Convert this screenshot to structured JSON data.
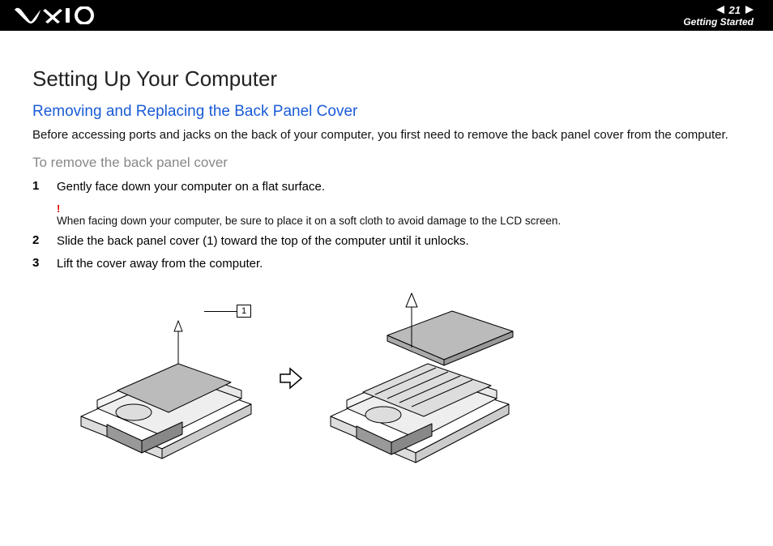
{
  "header": {
    "logo_alt": "VAIO",
    "page_number": "21",
    "section": "Getting Started"
  },
  "title": "Setting Up Your Computer",
  "subtitle": "Removing and Replacing the Back Panel Cover",
  "intro": "Before accessing ports and jacks on the back of your computer, you first need to remove the back panel cover from the computer.",
  "procedure_heading": "To remove the back panel cover",
  "steps": [
    {
      "num": "1",
      "text": "Gently face down your computer on a flat surface."
    },
    {
      "num": "2",
      "text": "Slide the back panel cover (1) toward the top of the computer until it unlocks."
    },
    {
      "num": "3",
      "text": "Lift the cover away from the computer."
    }
  ],
  "note": {
    "marker": "!",
    "text": "When facing down your computer, be sure to place it on a soft cloth to avoid damage to the LCD screen."
  },
  "figure": {
    "callout_label": "1"
  }
}
